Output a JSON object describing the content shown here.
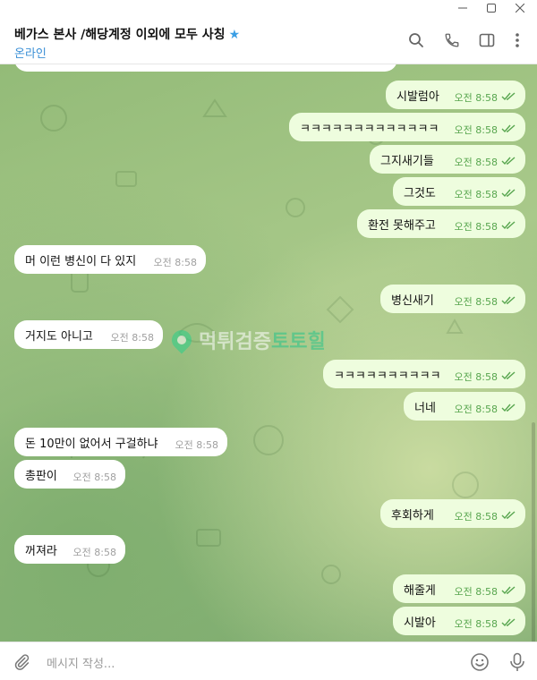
{
  "header": {
    "title": "베가스 본사 /해당계정 이외에 모두 사칭",
    "status": "온라인"
  },
  "watermark": {
    "part1": "먹튀검증",
    "part2": "토토힐"
  },
  "messages": [
    {
      "text": "시발럼아",
      "time": "오전 8:58",
      "dir": "out"
    },
    {
      "text": "ㅋㅋㅋㅋㅋㅋㅋㅋㅋㅋㅋㅋㅋ",
      "time": "오전 8:58",
      "dir": "out"
    },
    {
      "text": "그지새기들",
      "time": "오전 8:58",
      "dir": "out"
    },
    {
      "text": "그것도",
      "time": "오전 8:58",
      "dir": "out"
    },
    {
      "text": "환전 못해주고",
      "time": "오전 8:58",
      "dir": "out"
    },
    {
      "text": "머 이런 병신이 다 있지",
      "time": "오전 8:58",
      "dir": "in"
    },
    {
      "text": "병신새기",
      "time": "오전 8:58",
      "dir": "out"
    },
    {
      "text": "거지도 아니고",
      "time": "오전 8:58",
      "dir": "in"
    },
    {
      "text": "ㅋㅋㅋㅋㅋㅋㅋㅋㅋㅋ",
      "time": "오전 8:58",
      "dir": "out"
    },
    {
      "text": "너네",
      "time": "오전 8:58",
      "dir": "out"
    },
    {
      "text": "돈 10만이 없어서 구걸하냐",
      "time": "오전 8:58",
      "dir": "in"
    },
    {
      "text": "총판이",
      "time": "오전 8:58",
      "dir": "in"
    },
    {
      "text": "후회하게",
      "time": "오전 8:58",
      "dir": "out"
    },
    {
      "text": "꺼져라",
      "time": "오전 8:58",
      "dir": "in"
    },
    {
      "text": "해줄게",
      "time": "오전 8:58",
      "dir": "out"
    },
    {
      "text": "시발아",
      "time": "오전 8:58",
      "dir": "out"
    }
  ],
  "composer": {
    "placeholder": "메시지 작성..."
  },
  "colors": {
    "accent": "#3a9ee4",
    "outgoing_bubble": "#eefdde",
    "incoming_bubble": "#ffffff",
    "check": "#58a64f"
  }
}
